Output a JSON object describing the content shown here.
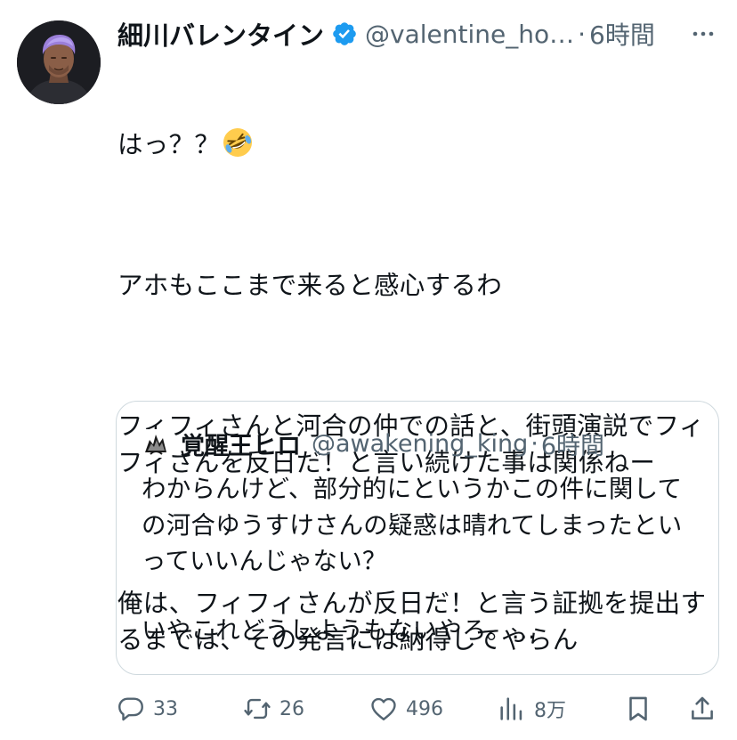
{
  "author": {
    "display_name": "細川バレンタイン",
    "handle": "@valentine_ho…",
    "separator": "·",
    "time": "6時間",
    "verified_color": "#1d9bf0"
  },
  "tweet": {
    "first_line": "はっ？？",
    "first_line_emoji": "rolling-on-floor-laughing-emoji",
    "paragraphs": [
      "アホもここまで来ると感心するわ",
      "フィフィさんと河合の仲での話と、街頭演説でフィフィさんを反日だ！と言い続けた事は関係ねー",
      "俺は、フィフィさんが反日だ！と言う証拠を提出するまでは、その発言には納得してやらん"
    ]
  },
  "quoted": {
    "display_name": "覚醒王ヒロ",
    "handle": "@awakening_king",
    "separator": "·",
    "time": "6時間",
    "paragraphs": [
      "わからんけど、部分的にというかこの件に関しての河合ゆうすけさんの疑惑は晴れてしまったといっていいんじゃない？",
      "いやこれどうしようもないやろ。…"
    ]
  },
  "actions": {
    "reply_count": "33",
    "retweet_count": "26",
    "like_count": "496",
    "view_count": "8万",
    "icons": [
      "reply-icon",
      "retweet-icon",
      "like-icon",
      "views-icon",
      "bookmark-icon",
      "share-icon"
    ]
  },
  "colors": {
    "text": "#0f1419",
    "secondary": "#536471",
    "border": "#cfd9de",
    "accent": "#1d9bf0"
  }
}
